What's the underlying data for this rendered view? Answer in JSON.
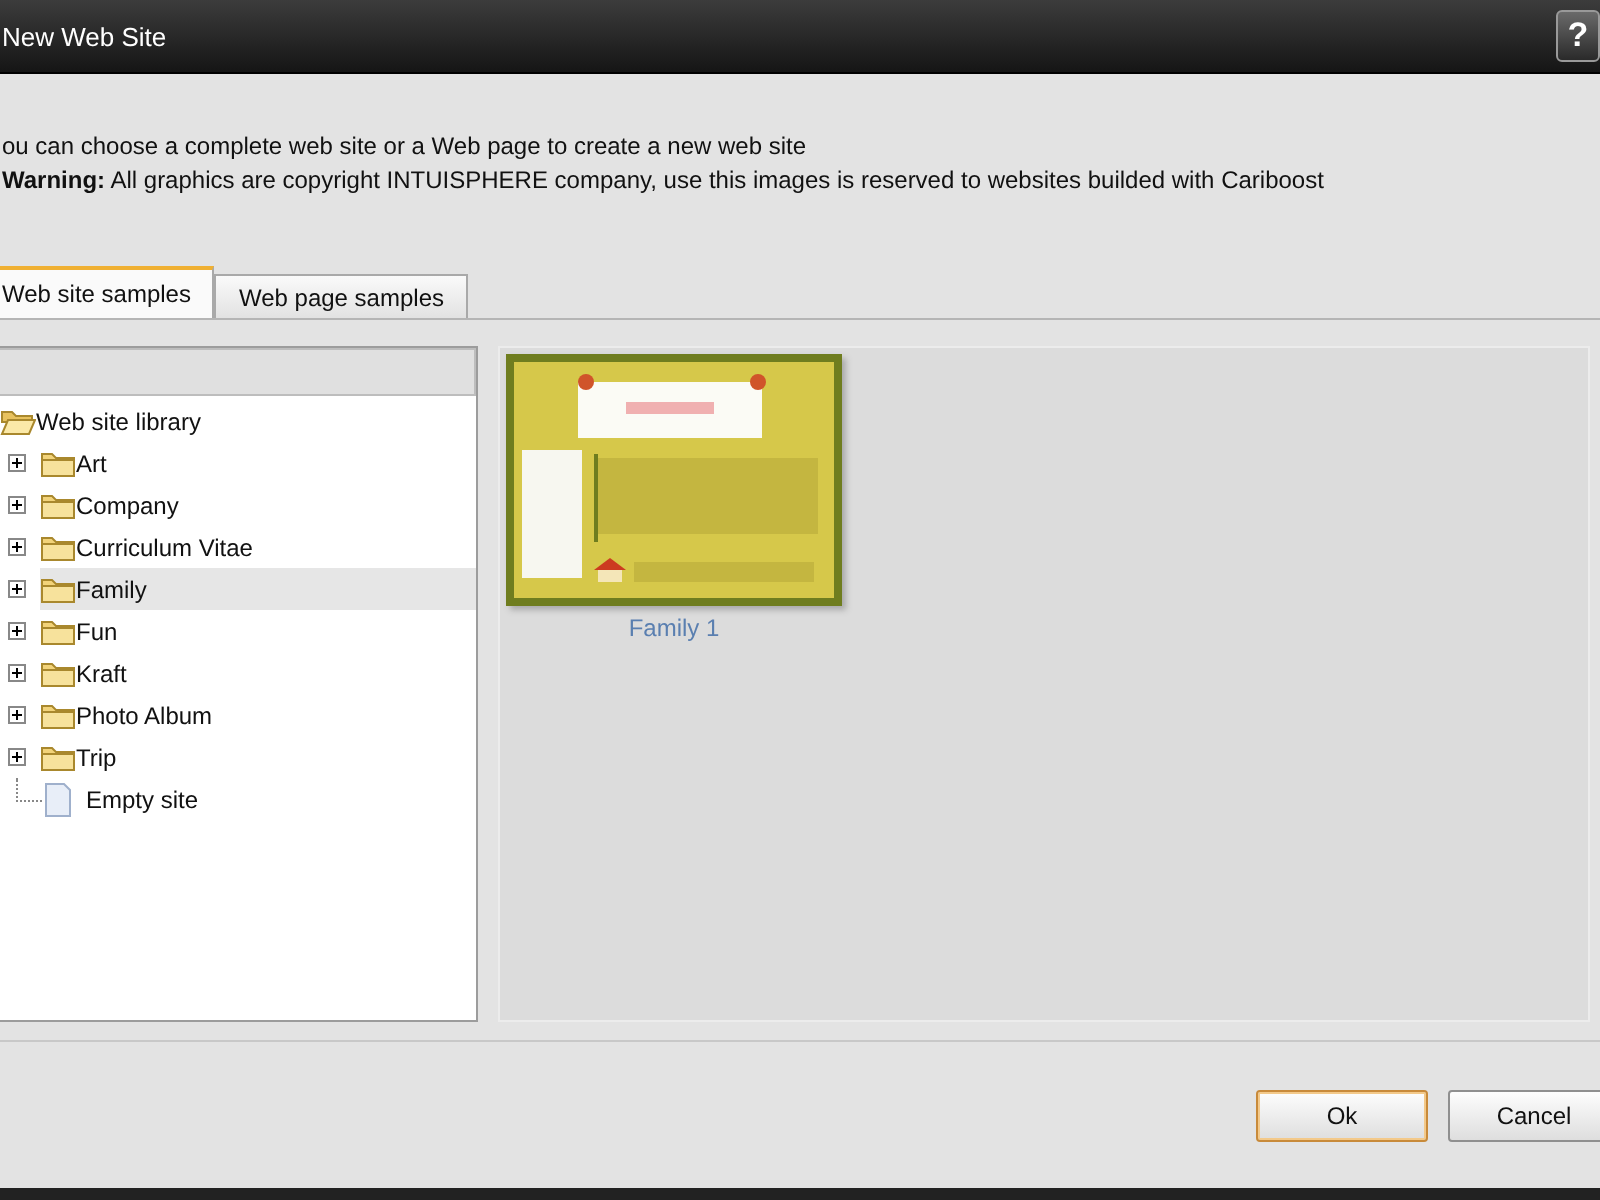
{
  "window": {
    "title": "New Web Site",
    "help_button": "?"
  },
  "intro": "ou can choose a complete web site or a Web page to create a new web site",
  "warning": "**Warning:** All graphics are copyright INTUISPHERE company, use this images is reserved to websites builded with Cariboost",
  "tabs": [
    {
      "label": "Web site samples",
      "selected": true
    },
    {
      "label": "Web page samples",
      "selected": false
    }
  ],
  "tree": {
    "label": "Web site library",
    "kind": "folder",
    "expanded": true,
    "selected": false,
    "children": [
      {
        "label": "Art",
        "kind": "folder",
        "selected": false
      },
      {
        "label": "Company",
        "kind": "folder",
        "selected": false
      },
      {
        "label": "Curriculum Vitae",
        "kind": "folder",
        "selected": false
      },
      {
        "label": "Family",
        "kind": "folder",
        "selected": true
      },
      {
        "label": "Fun",
        "kind": "folder",
        "selected": false
      },
      {
        "label": "Kraft",
        "kind": "folder",
        "selected": false
      },
      {
        "label": "Photo Album",
        "kind": "folder",
        "selected": false
      },
      {
        "label": "Trip",
        "kind": "folder",
        "selected": false
      },
      {
        "label": "Empty site",
        "kind": "file",
        "selected": false
      }
    ]
  },
  "samples": [
    {
      "label": "Family 1",
      "kind": "picture"
    }
  ],
  "buttons": [
    {
      "label": "Ok",
      "default": true
    },
    {
      "label": "Cancel",
      "default": false
    }
  ]
}
